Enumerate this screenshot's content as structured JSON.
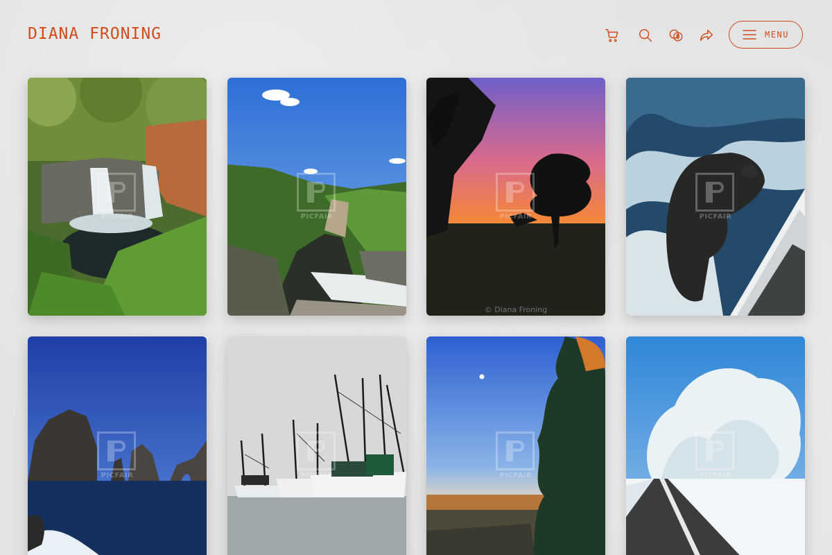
{
  "header": {
    "brand": "DIANA FRONING",
    "menu_label": "MENU",
    "icons": [
      "cart-icon",
      "search-icon",
      "currency-icon",
      "share-icon",
      "hamburger-icon"
    ],
    "accent": "#d14b1b"
  },
  "gallery": {
    "watermark": "PICFAIR",
    "credit": "© Diana Froning",
    "items": [
      {
        "subject": "waterfall"
      },
      {
        "subject": "river-canyon"
      },
      {
        "subject": "sunset-trees"
      },
      {
        "subject": "sea-lion-boat"
      },
      {
        "subject": "sea-rocks-arch"
      },
      {
        "subject": "shrimp-boats-harbor"
      },
      {
        "subject": "evergreen-moon-field"
      },
      {
        "subject": "frosted-trees-road"
      }
    ]
  }
}
